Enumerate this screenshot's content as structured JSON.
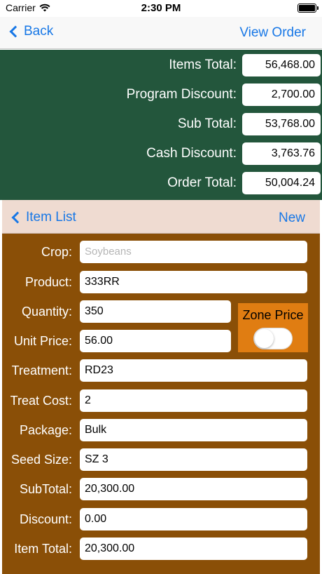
{
  "status_bar": {
    "carrier": "Carrier",
    "time": "2:30 PM"
  },
  "nav": {
    "back_label": "Back",
    "view_order_label": "View Order"
  },
  "summary": [
    {
      "label": "Items Total:",
      "value": "56,468.00"
    },
    {
      "label": "Program Discount:",
      "value": "2,700.00"
    },
    {
      "label": "Sub Total:",
      "value": "53,768.00"
    },
    {
      "label": "Cash Discount:",
      "value": "3,763.76"
    },
    {
      "label": "Order Total:",
      "value": "50,004.24"
    }
  ],
  "item_header": {
    "back_label": "Item List",
    "new_label": "New"
  },
  "form": {
    "crop": {
      "label": "Crop:",
      "placeholder": "Soybeans"
    },
    "product": {
      "label": "Product:",
      "value": "333RR"
    },
    "quantity": {
      "label": "Quantity:",
      "value": "350"
    },
    "unit_price": {
      "label": "Unit Price:",
      "value": "56.00"
    },
    "treatment": {
      "label": "Treatment:",
      "value": "RD23"
    },
    "treat_cost": {
      "label": "Treat Cost:",
      "value": "2"
    },
    "package": {
      "label": "Package:",
      "value": "Bulk"
    },
    "seed_size": {
      "label": "Seed Size:",
      "value": "SZ 3"
    },
    "subtotal": {
      "label": "SubTotal:",
      "value": "20,300.00"
    },
    "discount": {
      "label": "Discount:",
      "value": "0.00"
    },
    "item_total": {
      "label": "Item Total:",
      "value": "20,300.00"
    }
  },
  "zone_price": {
    "label": "Zone Price",
    "enabled": false
  },
  "colors": {
    "summary_bg": "#23563c",
    "header_bg": "#efdbd1",
    "form_bg": "#8a4f07",
    "zone_bg": "#e07d12",
    "link": "#1777e6"
  },
  "icons": [
    "wifi-icon",
    "battery-icon",
    "chevron-left-icon"
  ]
}
